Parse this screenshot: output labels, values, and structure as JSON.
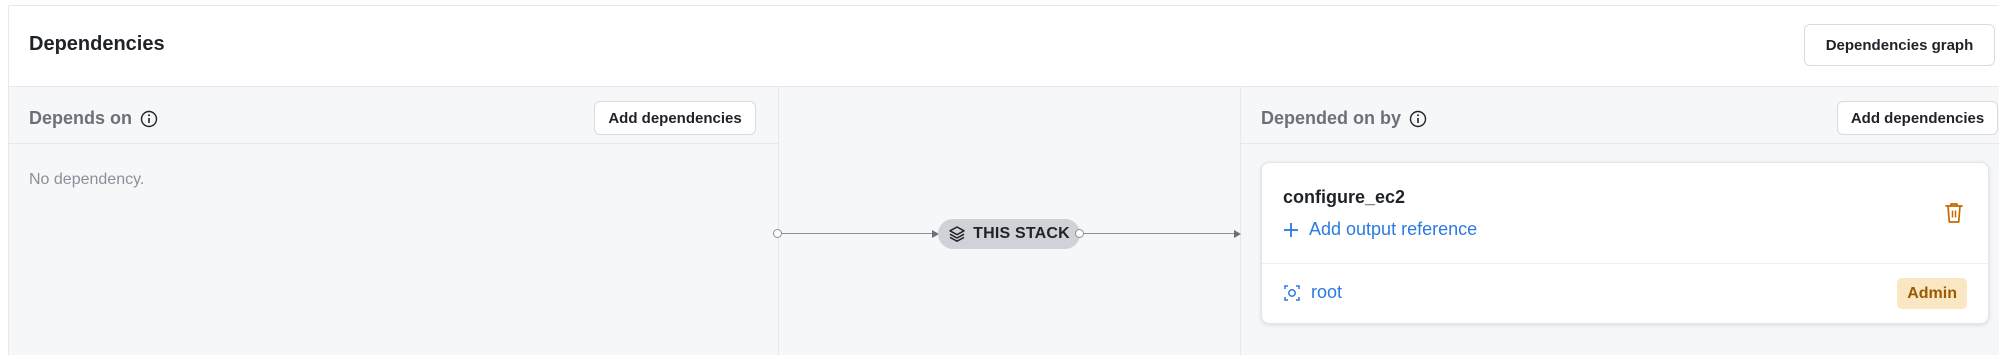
{
  "header": {
    "title": "Dependencies",
    "graph_button": "Dependencies graph"
  },
  "depends_on": {
    "label": "Depends on",
    "info_icon": "info-icon",
    "add_button": "Add dependencies",
    "empty_text": "No dependency."
  },
  "center": {
    "stack_label": "THIS STACK",
    "stack_icon": "layers-icon"
  },
  "depended_on_by": {
    "label": "Depended on by",
    "info_icon": "info-icon",
    "add_button": "Add dependencies",
    "items": [
      {
        "name": "configure_ec2",
        "add_output_reference": "Add output reference",
        "space": "root",
        "role_badge": "Admin"
      }
    ]
  },
  "colors": {
    "link": "#2a7ae2",
    "badge_bg": "#fbe6c4",
    "badge_text": "#9a5a00",
    "trash": "#c56a00"
  }
}
